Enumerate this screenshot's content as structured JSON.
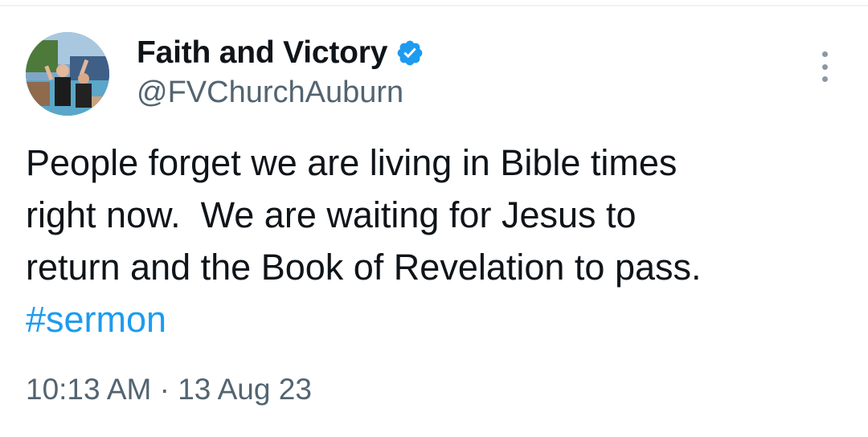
{
  "tweet": {
    "author": {
      "display_name": "Faith and Victory",
      "handle": "@FVChurchAuburn",
      "verified": true
    },
    "text_lines": [
      "People forget we are living in Bible times",
      "right now.  We are waiting for Jesus to",
      "return and the Book of Revelation to pass."
    ],
    "hashtag": "#sermon",
    "time": "10:13 AM",
    "separator": "·",
    "date": "13 Aug 23"
  },
  "colors": {
    "text": "#0f1419",
    "secondary": "#536471",
    "accent": "#1d9bf0",
    "verified_badge": "#1d9bf0"
  },
  "icons": {
    "more": "more-vertical-icon",
    "verified": "verified-badge-icon"
  }
}
